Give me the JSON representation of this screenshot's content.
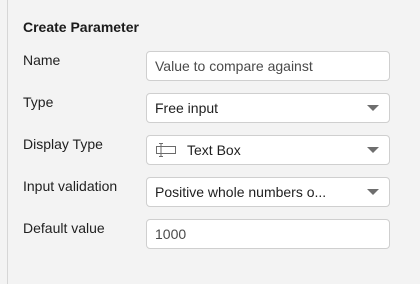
{
  "panel": {
    "title": "Create Parameter"
  },
  "fields": {
    "name": {
      "label": "Name",
      "value": "Value to compare against"
    },
    "type": {
      "label": "Type",
      "value": "Free input"
    },
    "display_type": {
      "label": "Display Type",
      "value": "Text Box",
      "icon": "text-box-icon"
    },
    "input_validation": {
      "label": "Input validation",
      "value": "Positive whole numbers o..."
    },
    "default_value": {
      "label": "Default value",
      "value": "1000"
    }
  },
  "icons": {
    "dropdown": "chevron-down-icon"
  }
}
